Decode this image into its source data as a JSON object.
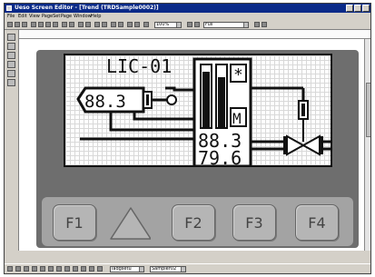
{
  "window": {
    "title": "Ueso Screen Editor - [Trend (TRDSample0002)]"
  },
  "menu": [
    "File",
    "Edit",
    "View",
    "PageSet",
    "Page",
    "Window",
    "Help"
  ],
  "toolbar": {
    "zoom": "100%",
    "layer": "Full"
  },
  "statusbar": {
    "combo1": "ladgsetu",
    "combo2": "Sampler02"
  },
  "hmi": {
    "tag": "LIC-01",
    "pv_display": "88.3",
    "value_top": "88.3",
    "value_bottom": "79.6",
    "alarm_symbol": "*",
    "mode": "M",
    "keys": [
      "F1",
      "F2",
      "F3",
      "F4"
    ]
  },
  "icons": [
    "window-icon",
    "minimize-icon",
    "maximize-icon",
    "close-icon",
    "triangle-key-icon",
    "valve-icon"
  ]
}
